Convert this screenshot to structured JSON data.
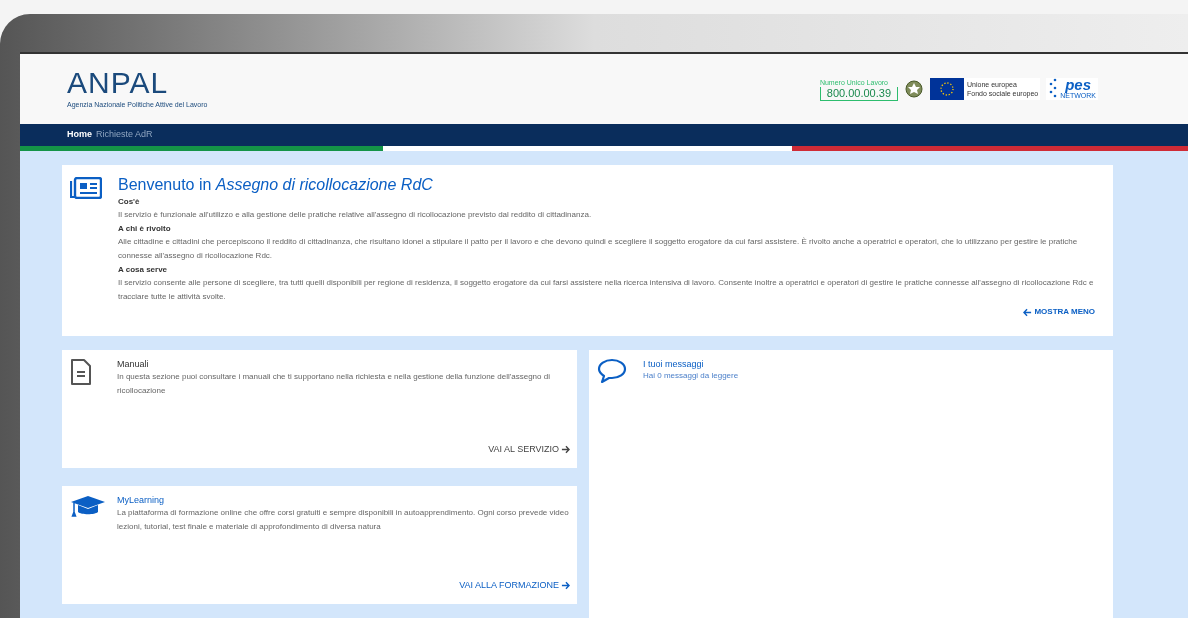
{
  "header": {
    "logo": {
      "name": "ANPAL",
      "subtitle": "Agenzia Nazionale Politiche Attive del Lavoro"
    },
    "hotline": {
      "label": "Numero Unico Lavoro",
      "number": "800.00.00.39"
    },
    "eu": {
      "line_1": "Unione europea",
      "line_2": "Fondo sociale europeo"
    },
    "pes": {
      "name": "pes",
      "sub": "NETWORK"
    }
  },
  "nav": [
    {
      "label": "Home",
      "selected": true
    },
    {
      "label": "Richieste AdR",
      "selected": false
    }
  ],
  "welcome": {
    "title_prefix": "Benvenuto in",
    "title_service": "Assegno di ricollocazione RdC",
    "sections": [
      {
        "heading": "Cos'è",
        "text": "Il servizio è funzionale all'utilizzo e alla gestione delle pratiche relative all'assegno di ricollocazione previsto dal reddito di cittadinanza."
      },
      {
        "heading": "A chi è rivolto",
        "text": "Alle cittadine e cittadini che percepiscono il reddito di cittadinanza, che risultano idonei a stipulare il patto per il lavoro e che devono quindi e scegliere il soggetto erogatore da cui farsi assistere. È rivolto anche a operatrici e operatori, che lo utilizzano per gestire le pratiche connesse all'assegno di ricollocazione Rdc."
      },
      {
        "heading": "A cosa serve",
        "text": "Il servizio consente alle persone di scegliere, tra tutti quelli disponibili per regione di residenza, il soggetto erogatore da cui farsi assistere nella ricerca intensiva di lavoro. Consente inoltre a operatrici e operatori di gestire le pratiche connesse all'assegno di ricollocazione Rdc e tracciare tutte le attività svolte."
      }
    ],
    "toggle": "MOSTRA MENO"
  },
  "cards": [
    {
      "kind": "manuals",
      "title": "Manuali",
      "text": "In questa sezione puoi consultare i manuali che ti supportano nella richiesta e nella gestione della funzione dell'assegno di ricollocazione",
      "link": "VAI AL SERVIZIO"
    },
    {
      "kind": "learning",
      "title": "MyLearning",
      "text": "La piattaforma di formazione online che offre corsi gratuiti e sempre disponibili in autoapprendimento. Ogni corso prevede video lezioni, tutorial, test finale e materiale di approfondimento di diversa natura",
      "link": "VAI ALLA FORMAZIONE"
    }
  ],
  "messages": {
    "title": "I tuoi messaggi",
    "text": "Hai 0 messaggi da leggere"
  }
}
